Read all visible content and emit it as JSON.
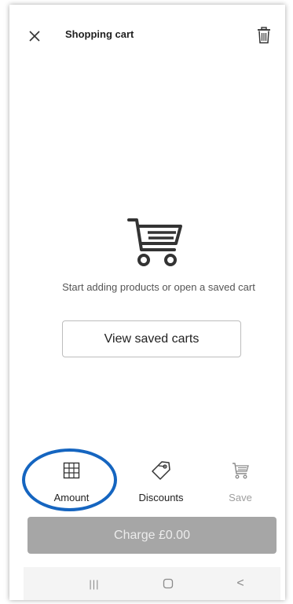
{
  "header": {
    "title": "Shopping cart",
    "close_icon": "close-icon",
    "trash_icon": "trash-icon"
  },
  "empty_state": {
    "icon": "cart-icon",
    "message": "Start adding products or open a saved cart",
    "view_saved_label": "View saved carts"
  },
  "actions": [
    {
      "label": "Amount",
      "icon": "grid-icon",
      "enabled": true,
      "highlighted": true
    },
    {
      "label": "Discounts",
      "icon": "tag-icon",
      "enabled": true
    },
    {
      "label": "Save",
      "icon": "cart-icon",
      "enabled": false
    }
  ],
  "charge": {
    "label": "Charge £0.00",
    "enabled": false
  },
  "navigation": {
    "recents_glyph": "|||",
    "home_icon": "home-icon",
    "back_glyph": "<"
  },
  "colors": {
    "highlight": "#1565c0",
    "charge_disabled_bg": "#a6a6a6",
    "save_disabled_text": "#9e9e9e"
  }
}
